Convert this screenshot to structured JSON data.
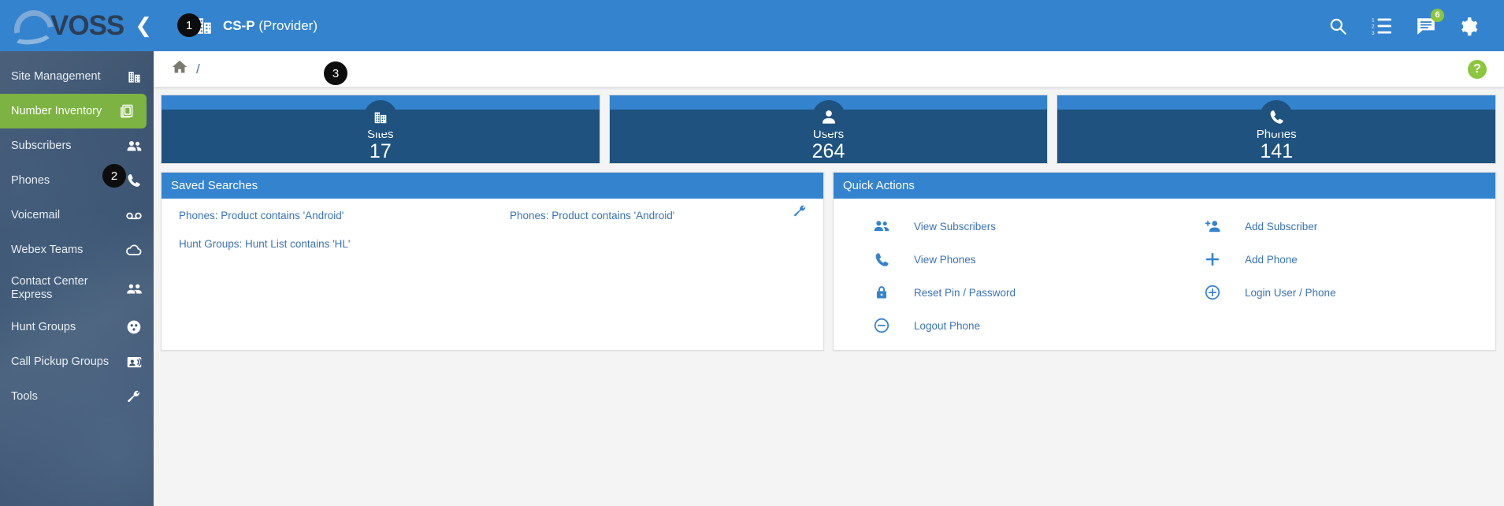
{
  "header": {
    "logo_text": "VOSS",
    "collapse_icon": "chevron-left-icon",
    "context_icon": "building-icon",
    "context_name": "CS-P",
    "context_role": "(Provider)",
    "icons": [
      {
        "name": "search-icon",
        "label": "Search"
      },
      {
        "name": "numbered-list-icon",
        "label": "Transactions"
      },
      {
        "name": "message-icon",
        "label": "Messages",
        "badge": "6"
      },
      {
        "name": "gear-icon",
        "label": "Settings"
      }
    ]
  },
  "sidebar": {
    "items": [
      {
        "label": "Site Management",
        "icon": "site-building-icon",
        "active": false
      },
      {
        "label": "Number Inventory",
        "icon": "number-inventory-icon",
        "active": true
      },
      {
        "label": "Subscribers",
        "icon": "people-icon",
        "active": false
      },
      {
        "label": "Phones",
        "icon": "phone-icon",
        "active": false
      },
      {
        "label": "Voicemail",
        "icon": "voicemail-icon",
        "active": false
      },
      {
        "label": "Webex Teams",
        "icon": "cloud-icon",
        "active": false
      },
      {
        "label": "Contact Center Express",
        "icon": "contact-center-icon",
        "active": false
      },
      {
        "label": "Hunt Groups",
        "icon": "hunt-group-icon",
        "active": false
      },
      {
        "label": "Call Pickup Groups",
        "icon": "call-pickup-icon",
        "active": false
      },
      {
        "label": "Tools",
        "icon": "wrench-icon",
        "active": false
      }
    ]
  },
  "breadcrumb": {
    "home_icon": "home-icon",
    "separator": "/",
    "help_icon": "question-mark-icon",
    "help_label": "?"
  },
  "stats": [
    {
      "name": "Sites",
      "value": "17",
      "icon": "building-icon"
    },
    {
      "name": "Users",
      "value": "264",
      "icon": "person-icon"
    },
    {
      "name": "Phones",
      "value": "141",
      "icon": "phone-icon"
    }
  ],
  "saved_searches": {
    "title": "Saved Searches",
    "config_icon": "wrench-icon",
    "column_left": [
      "Phones: Product contains 'Android'",
      "Hunt Groups: Hunt List contains 'HL'"
    ],
    "column_right": [
      "Phones: Product contains 'Android'"
    ]
  },
  "quick_actions": {
    "title": "Quick Actions",
    "column_left": [
      {
        "label": "View Subscribers",
        "icon": "people-icon"
      },
      {
        "label": "View Phones",
        "icon": "phone-icon"
      },
      {
        "label": "Reset Pin / Password",
        "icon": "lock-icon"
      },
      {
        "label": "Logout Phone",
        "icon": "minus-circle-icon"
      }
    ],
    "column_right": [
      {
        "label": "Add Subscriber",
        "icon": "person-add-icon"
      },
      {
        "label": "Add Phone",
        "icon": "plus-icon"
      },
      {
        "label": "Login User / Phone",
        "icon": "plus-circle-icon"
      }
    ]
  },
  "annotations": [
    {
      "id": "1",
      "label": "1"
    },
    {
      "id": "2",
      "label": "2"
    },
    {
      "id": "3",
      "label": "3"
    }
  ],
  "colors": {
    "brand_blue": "#3483cf",
    "dark_blue": "#1f527f",
    "accent_green": "#7cb342",
    "link_blue": "#3a73b8",
    "sidebar_dark": "#3a5370"
  }
}
